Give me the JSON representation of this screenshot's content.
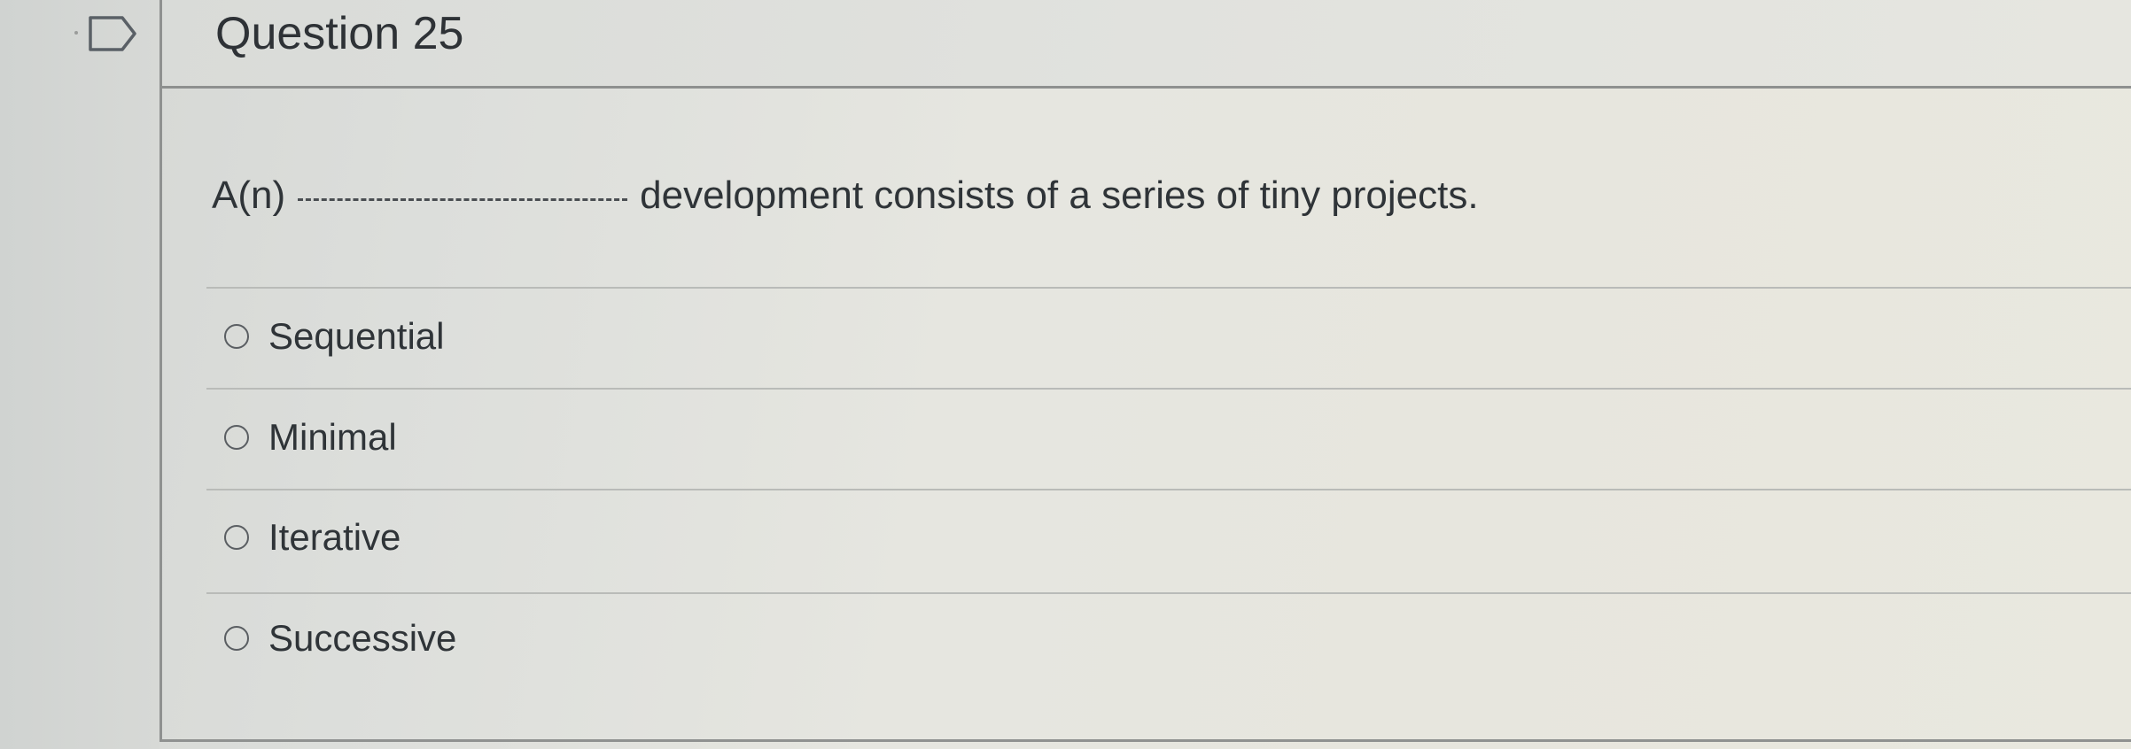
{
  "question": {
    "title": "Question 25",
    "prompt_before": "A(n)",
    "prompt_after": "development consists of a series of tiny projects."
  },
  "options": [
    {
      "label": "Sequential",
      "selected": false
    },
    {
      "label": "Minimal",
      "selected": false
    },
    {
      "label": "Iterative",
      "selected": false
    },
    {
      "label": "Successive",
      "selected": false
    }
  ],
  "icons": {
    "flag": "flag-icon"
  }
}
